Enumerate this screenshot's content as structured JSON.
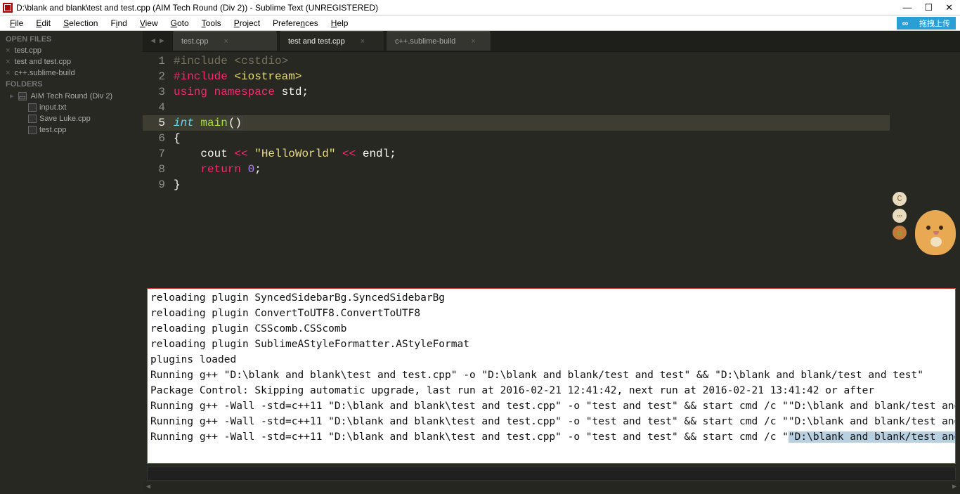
{
  "window": {
    "title": "D:\\blank and blank\\test and test.cpp (AIM Tech Round (Div 2)) - Sublime Text (UNREGISTERED)"
  },
  "menu": {
    "items": [
      "File",
      "Edit",
      "Selection",
      "Find",
      "View",
      "Goto",
      "Tools",
      "Project",
      "Preferences",
      "Help"
    ],
    "upload_label": "拖拽上传"
  },
  "sidebar": {
    "open_files_label": "OPEN FILES",
    "open_files": [
      {
        "name": "test.cpp"
      },
      {
        "name": "test and test.cpp"
      },
      {
        "name": "c++.sublime-build"
      }
    ],
    "folders_label": "FOLDERS",
    "folders": [
      {
        "name": "AIM Tech Round (Div 2)",
        "files": [
          {
            "name": "input.txt"
          },
          {
            "name": "Save Luke.cpp"
          },
          {
            "name": "test.cpp"
          }
        ]
      }
    ]
  },
  "tabs": [
    {
      "label": "test.cpp",
      "active": false
    },
    {
      "label": "test and test.cpp",
      "active": true
    },
    {
      "label": "c++.sublime-build",
      "active": false
    }
  ],
  "code": {
    "lines": [
      "1",
      "2",
      "3",
      "4",
      "5",
      "6",
      "7",
      "8",
      "9"
    ],
    "current_line": 5,
    "tokens": {
      "l1_pre": "#include <cstdio>",
      "l2_inc": "#include",
      "l2_hdr": " <iostream>",
      "l3_using": "using",
      "l3_ns": " namespace",
      "l3_std": " std",
      "l3_semi": ";",
      "l5_int": "int",
      "l5_main": " main",
      "l5_paren": "()",
      "l6_brace": "{",
      "l7_pad": "    ",
      "l7_cout": "cout ",
      "l7_op1": "<<",
      "l7_str": " \"HelloWorld\" ",
      "l7_op2": "<<",
      "l7_endl": " endl",
      "l7_semi": ";",
      "l8_pad": "    ",
      "l8_ret": "return",
      "l8_zero": " 0",
      "l8_semi": ";",
      "l9_brace": "}"
    }
  },
  "console": {
    "l1": "reloading plugin SyncedSidebarBg.SyncedSidebarBg",
    "l2": "reloading plugin ConvertToUTF8.ConvertToUTF8",
    "l3": "reloading plugin CSScomb.CSScomb",
    "l4": "reloading plugin SublimeAStyleFormatter.AStyleFormat",
    "l5": "plugins loaded",
    "l6": "Running g++ \"D:\\blank and blank\\test and test.cpp\" -o \"D:\\blank and blank/test and test\" && \"D:\\blank and blank/test and test\"",
    "l7": "Package Control: Skipping automatic upgrade, last run at 2016-02-21 12:41:42, next run at 2016-02-21 13:41:42 or after",
    "l8": "Running g++ -Wall -std=c++11 \"D:\\blank and blank\\test and test.cpp\" -o \"test and test\" && start cmd /c \"\"D:\\blank and blank/test and t",
    "l9": "Running g++ -Wall -std=c++11 \"D:\\blank and blank\\test and test.cpp\" -o \"test and test\" && start cmd /c \"\"D:\\blank and blank/test and t",
    "l10a": "Running g++ -Wall -std=c++11 \"D:\\blank and blank\\test and test.cpp\" -o \"test and test\" && start cmd /c \"",
    "l10b": "\"D:\\blank and blank/test and t"
  }
}
